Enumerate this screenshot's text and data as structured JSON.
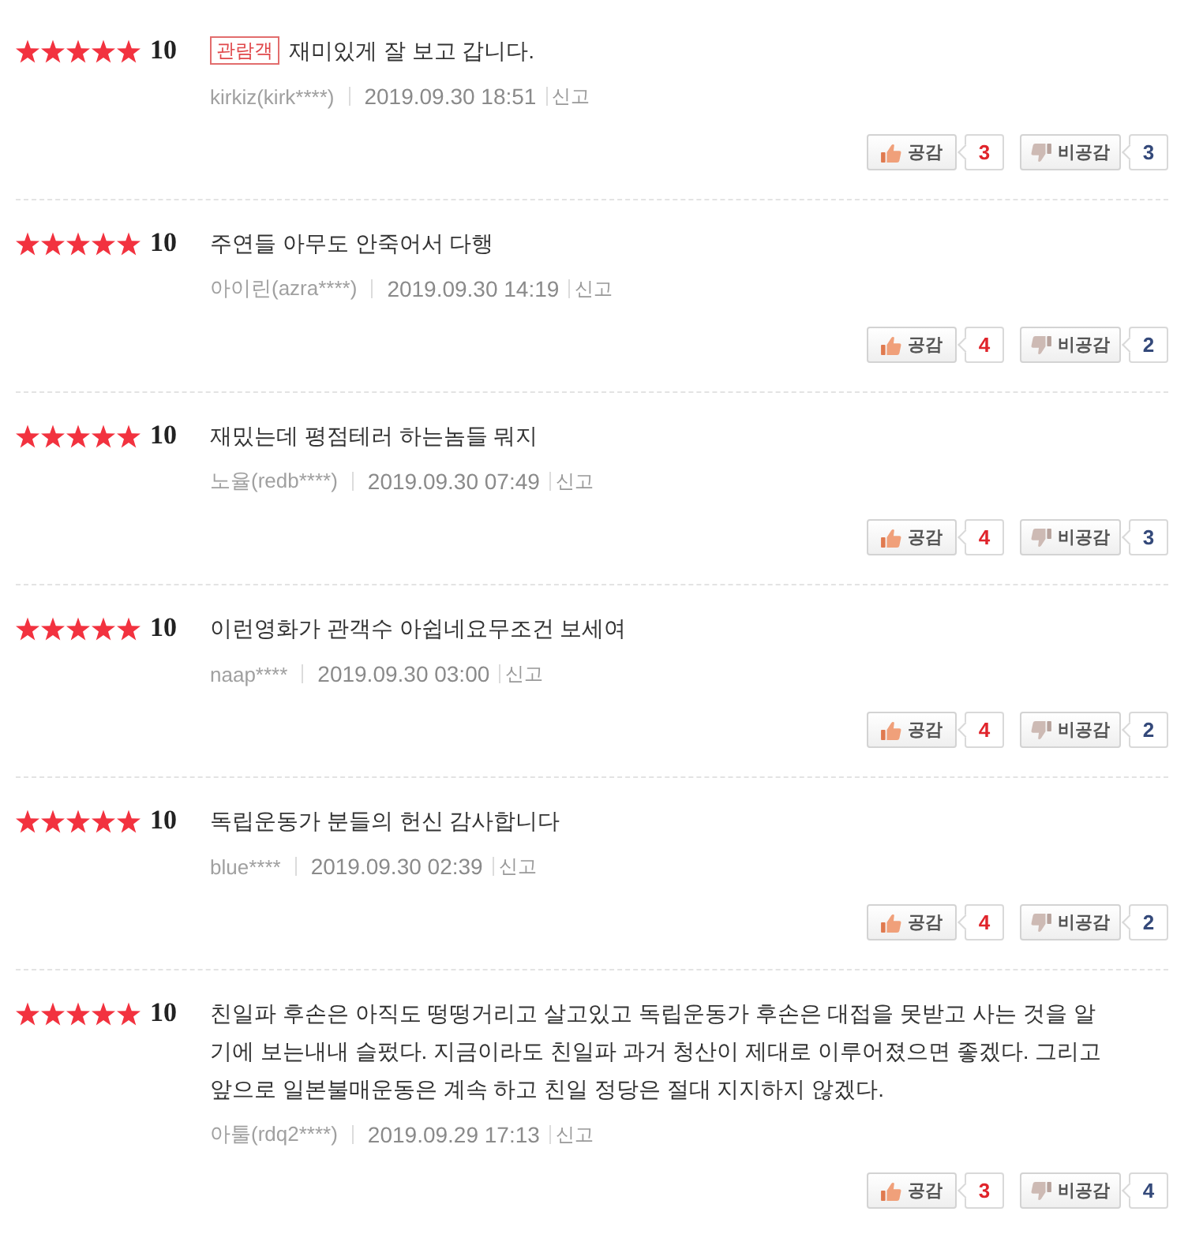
{
  "reviews": [
    {
      "stars": 5,
      "score": "10",
      "badge": "관람객",
      "comment": "재미있게 잘 보고 갑니다.",
      "author": "kirkiz(kirk****)",
      "date": "2019.09.30 18:51",
      "report": "신고",
      "like": {
        "label": "공감",
        "count": "3"
      },
      "dislike": {
        "label": "비공감",
        "count": "3"
      }
    },
    {
      "stars": 5,
      "score": "10",
      "comment": "주연들 아무도 안죽어서 다행",
      "author": "아이린(azra****)",
      "date": "2019.09.30 14:19",
      "report": "신고",
      "like": {
        "label": "공감",
        "count": "4"
      },
      "dislike": {
        "label": "비공감",
        "count": "2"
      }
    },
    {
      "stars": 5,
      "score": "10",
      "comment": "재밌는데 평점테러 하는놈들 뭐지",
      "author": "노율(redb****)",
      "date": "2019.09.30 07:49",
      "report": "신고",
      "like": {
        "label": "공감",
        "count": "4"
      },
      "dislike": {
        "label": "비공감",
        "count": "3"
      }
    },
    {
      "stars": 5,
      "score": "10",
      "comment": "이런영화가 관객수 아쉽네요무조건 보세여",
      "author": "naap****",
      "date": "2019.09.30 03:00",
      "report": "신고",
      "like": {
        "label": "공감",
        "count": "4"
      },
      "dislike": {
        "label": "비공감",
        "count": "2"
      }
    },
    {
      "stars": 5,
      "score": "10",
      "comment": "독립운동가 분들의 헌신 감사합니다",
      "author": "blue****",
      "date": "2019.09.30 02:39",
      "report": "신고",
      "like": {
        "label": "공감",
        "count": "4"
      },
      "dislike": {
        "label": "비공감",
        "count": "2"
      }
    },
    {
      "stars": 5,
      "score": "10",
      "comment": "친일파 후손은 아직도 떵떵거리고 살고있고 독립운동가 후손은 대접을 못받고 사는 것을 알기에 보는내내 슬펐다. 지금이라도 친일파 과거 청산이 제대로 이루어졌으면 좋겠다. 그리고 앞으로 일본불매운동은 계속 하고 친일 정당은 절대 지지하지 않겠다.",
      "author": "아툴(rdq2****)",
      "date": "2019.09.29 17:13",
      "report": "신고",
      "like": {
        "label": "공감",
        "count": "3"
      },
      "dislike": {
        "label": "비공감",
        "count": "4"
      }
    }
  ]
}
